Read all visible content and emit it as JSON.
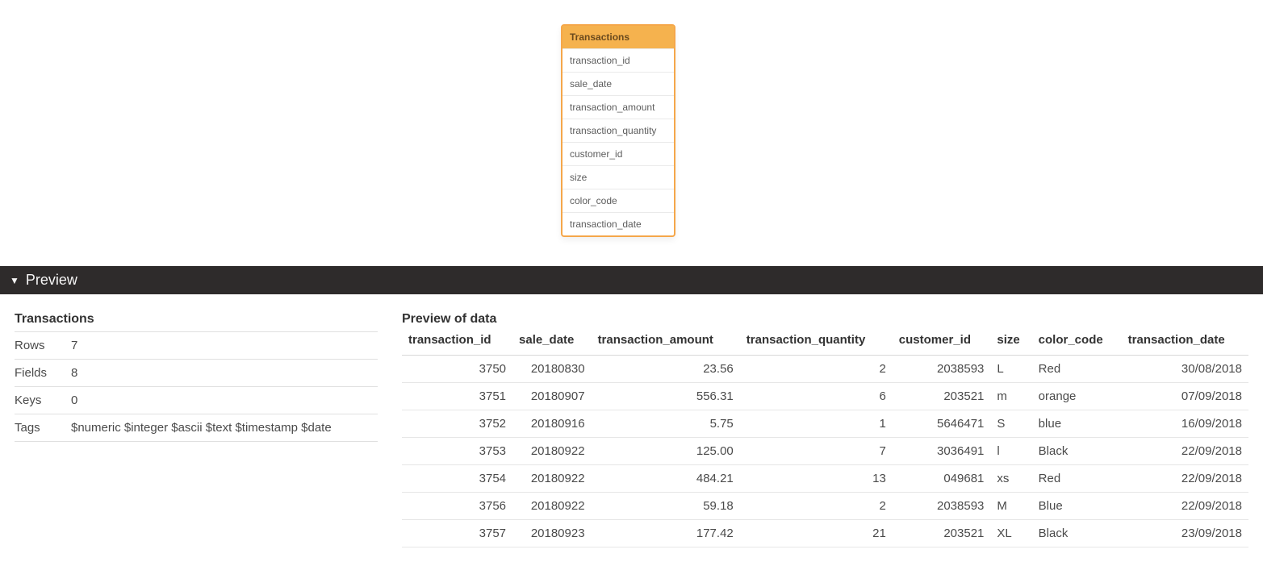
{
  "tableCard": {
    "title": "Transactions",
    "fields": [
      "transaction_id",
      "sale_date",
      "transaction_amount",
      "transaction_quantity",
      "customer_id",
      "size",
      "color_code",
      "transaction_date"
    ]
  },
  "previewBar": {
    "label": "Preview"
  },
  "meta": {
    "title": "Transactions",
    "rowsLabel": "Rows",
    "rowsValue": "7",
    "fieldsLabel": "Fields",
    "fieldsValue": "8",
    "keysLabel": "Keys",
    "keysValue": "0",
    "tagsLabel": "Tags",
    "tagsValue": "$numeric $integer $ascii $text $timestamp $date"
  },
  "dataPreview": {
    "title": "Preview of data",
    "columns": [
      {
        "key": "transaction_id",
        "label": "transaction_id",
        "align": "num"
      },
      {
        "key": "sale_date",
        "label": "sale_date",
        "align": "num"
      },
      {
        "key": "transaction_amount",
        "label": "transaction_amount",
        "align": "num"
      },
      {
        "key": "transaction_quantity",
        "label": "transaction_quantity",
        "align": "num"
      },
      {
        "key": "customer_id",
        "label": "customer_id",
        "align": "num"
      },
      {
        "key": "size",
        "label": "size",
        "align": "txt"
      },
      {
        "key": "color_code",
        "label": "color_code",
        "align": "txt"
      },
      {
        "key": "transaction_date",
        "label": "transaction_date",
        "align": "num"
      }
    ],
    "rows": [
      {
        "transaction_id": "3750",
        "sale_date": "20180830",
        "transaction_amount": "23.56",
        "transaction_quantity": "2",
        "customer_id": "2038593",
        "size": "L",
        "color_code": "Red",
        "transaction_date": "30/08/2018"
      },
      {
        "transaction_id": "3751",
        "sale_date": "20180907",
        "transaction_amount": "556.31",
        "transaction_quantity": "6",
        "customer_id": "203521",
        "size": "m",
        "color_code": "orange",
        "transaction_date": "07/09/2018"
      },
      {
        "transaction_id": "3752",
        "sale_date": "20180916",
        "transaction_amount": "5.75",
        "transaction_quantity": "1",
        "customer_id": "5646471",
        "size": "S",
        "color_code": "blue",
        "transaction_date": "16/09/2018"
      },
      {
        "transaction_id": "3753",
        "sale_date": "20180922",
        "transaction_amount": "125.00",
        "transaction_quantity": "7",
        "customer_id": "3036491",
        "size": "l",
        "color_code": "Black",
        "transaction_date": "22/09/2018"
      },
      {
        "transaction_id": "3754",
        "sale_date": "20180922",
        "transaction_amount": "484.21",
        "transaction_quantity": "13",
        "customer_id": "049681",
        "size": "xs",
        "color_code": "Red",
        "transaction_date": "22/09/2018"
      },
      {
        "transaction_id": "3756",
        "sale_date": "20180922",
        "transaction_amount": "59.18",
        "transaction_quantity": "2",
        "customer_id": "2038593",
        "size": "M",
        "color_code": "Blue",
        "transaction_date": "22/09/2018"
      },
      {
        "transaction_id": "3757",
        "sale_date": "20180923",
        "transaction_amount": "177.42",
        "transaction_quantity": "21",
        "customer_id": "203521",
        "size": "XL",
        "color_code": "Black",
        "transaction_date": "23/09/2018"
      }
    ]
  }
}
